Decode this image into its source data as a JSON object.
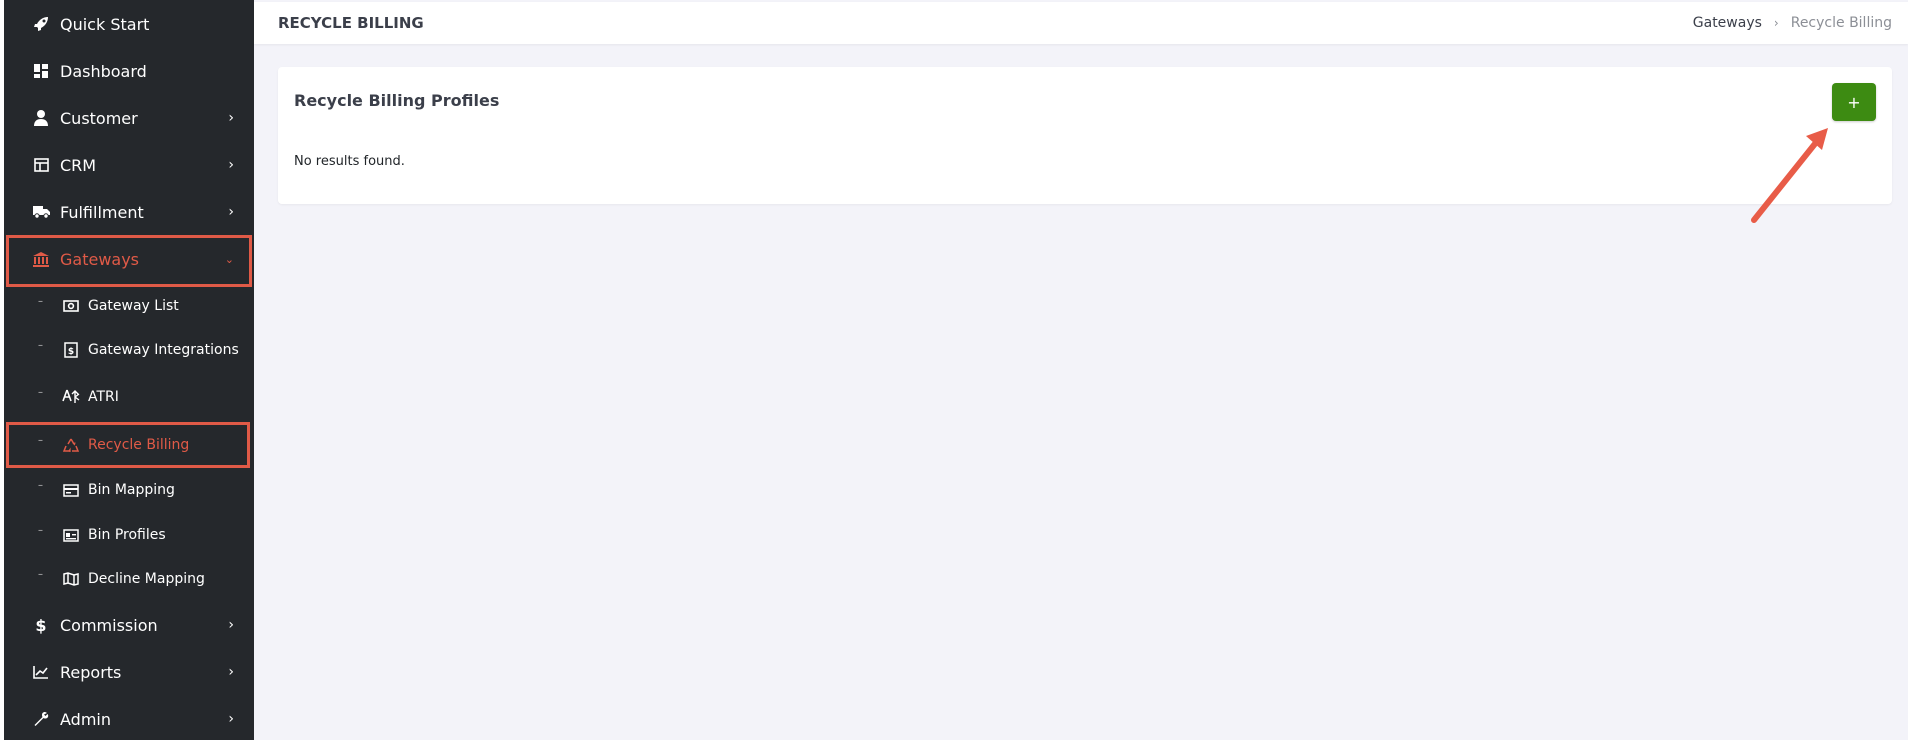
{
  "sidebar": {
    "items": [
      {
        "label": "Quick Start",
        "icon": "rocket-icon"
      },
      {
        "label": "Dashboard",
        "icon": "dashboard-icon"
      },
      {
        "label": "Customer",
        "icon": "user-icon"
      },
      {
        "label": "CRM",
        "icon": "crm-icon"
      },
      {
        "label": "Fulfillment",
        "icon": "truck-icon"
      },
      {
        "label": "Gateways",
        "icon": "bank-icon"
      }
    ],
    "sub_items": [
      {
        "label": "Gateway List",
        "icon": "money-icon"
      },
      {
        "label": "Gateway Integrations",
        "icon": "invoice-icon"
      },
      {
        "label": "ATRI",
        "icon": "network-icon"
      },
      {
        "label": "Recycle Billing",
        "icon": "recycle-icon"
      },
      {
        "label": "Bin Mapping",
        "icon": "card-icon"
      },
      {
        "label": "Bin Profiles",
        "icon": "id-card-icon"
      },
      {
        "label": "Decline Mapping",
        "icon": "map-icon"
      }
    ],
    "bottom_items": [
      {
        "label": "Commission",
        "icon": "dollar-icon"
      },
      {
        "label": "Reports",
        "icon": "chart-icon"
      },
      {
        "label": "Admin",
        "icon": "wrench-icon"
      }
    ]
  },
  "header": {
    "title": "RECYCLE BILLING",
    "breadcrumb": [
      "Gateways",
      "Recycle Billing"
    ]
  },
  "main": {
    "card_title": "Recycle Billing Profiles",
    "empty_text": "No results found.",
    "add_button": "+"
  },
  "colors": {
    "sidebar_bg": "#25282c",
    "accent": "#e05a47",
    "button_green": "#3d8b12",
    "page_bg": "#f3f3f9"
  }
}
